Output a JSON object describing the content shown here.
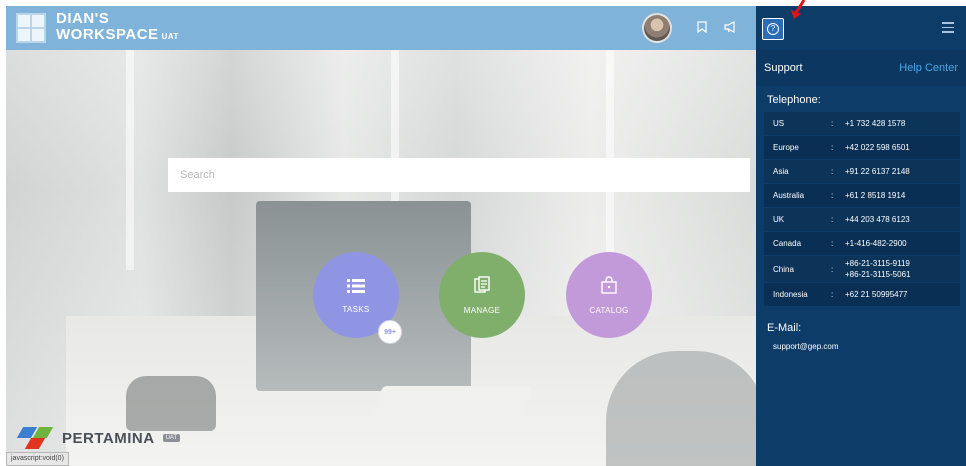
{
  "header": {
    "brand_line1": "DIAN'S",
    "brand_line2": "WORKSPACE",
    "brand_env": "UAT",
    "icons": [
      "user-avatar",
      "bookmark-icon",
      "megaphone-icon"
    ]
  },
  "search": {
    "placeholder": "Search",
    "value": ""
  },
  "tiles": [
    {
      "label": "TASKS",
      "icon": "list-icon",
      "badge": "99+"
    },
    {
      "label": "MANAGE",
      "icon": "documents-icon"
    },
    {
      "label": "CATALOG",
      "icon": "shopping-bag-icon"
    }
  ],
  "footer": {
    "company": "PERTAMINA",
    "env": "UAT"
  },
  "status_bar": {
    "text": "javascript:void(0)"
  },
  "panel": {
    "title": "Support",
    "help_link": "Help Center",
    "telephone_title": "Telephone:",
    "phones": [
      {
        "country": "US",
        "sep": ":",
        "numbers": [
          "+1 732 428 1578"
        ]
      },
      {
        "country": "Europe",
        "sep": ":",
        "numbers": [
          "+42 022 598 6501"
        ]
      },
      {
        "country": "Asia",
        "sep": ":",
        "numbers": [
          "+91 22 6137 2148"
        ]
      },
      {
        "country": "Australia",
        "sep": ":",
        "numbers": [
          "+61 2 8518 1914"
        ]
      },
      {
        "country": "UK",
        "sep": ":",
        "numbers": [
          "+44 203 478 6123"
        ]
      },
      {
        "country": "Canada",
        "sep": ":",
        "numbers": [
          "+1-416-482-2900"
        ]
      },
      {
        "country": "China",
        "sep": ":",
        "numbers": [
          "+86-21-3115-9119",
          "+86-21-3115-5061"
        ]
      },
      {
        "country": "Indonesia",
        "sep": ":",
        "numbers": [
          "+62 21 50995477"
        ]
      }
    ],
    "email_title": "E-Mail:",
    "email": "support@gep.com"
  },
  "colors": {
    "header_bg": "#7fb3d9",
    "panel_bg": "#0d3c68",
    "help_link": "#4ea6e9",
    "tasks": "#8f95e2",
    "manage": "#7faf6b",
    "catalog": "#c39ad9",
    "annotation_arrow": "#e3121a"
  }
}
